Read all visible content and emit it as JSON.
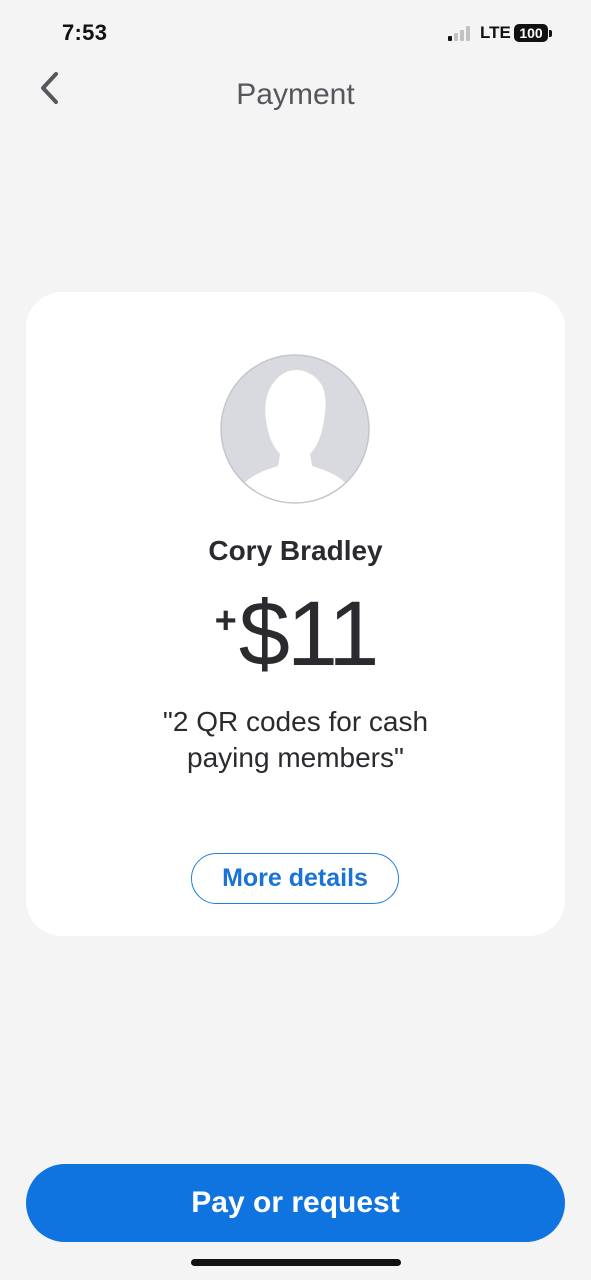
{
  "status_bar": {
    "time": "7:53",
    "network": "LTE",
    "battery": "100"
  },
  "header": {
    "back_icon": "chevron-left-icon",
    "title": "Payment"
  },
  "payment": {
    "avatar_icon": "default-person-avatar-icon",
    "name": "Cory Bradley",
    "amount_sign": "+",
    "amount": "$11",
    "note": "\"2 QR codes for cash paying members\"",
    "details_label": "More details"
  },
  "footer": {
    "pay_label": "Pay or request"
  },
  "colors": {
    "accent": "#0f74df",
    "background": "#f4f4f4",
    "card": "#ffffff",
    "text": "#2b2b2f"
  }
}
